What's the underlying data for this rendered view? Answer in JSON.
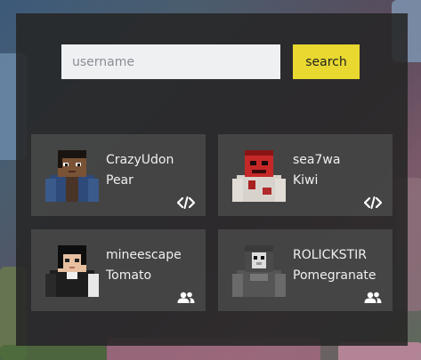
{
  "search": {
    "placeholder": "username",
    "value": "",
    "button_label": "search"
  },
  "players": [
    {
      "username": "CrazyUdon",
      "fruit": "Pear",
      "badge_icon": "code-icon"
    },
    {
      "username": "sea7wa",
      "fruit": "Kiwi",
      "badge_icon": "code-icon"
    },
    {
      "username": "mineescape",
      "fruit": "Tomato",
      "badge_icon": "users-icon"
    },
    {
      "username": "ROLICKSTIR",
      "fruit": "Pomegranate",
      "badge_icon": "users-icon"
    }
  ],
  "colors": {
    "accent": "#e8d830",
    "panel": "#262626",
    "card": "#4e4e4e",
    "text": "#f0f0f0"
  }
}
